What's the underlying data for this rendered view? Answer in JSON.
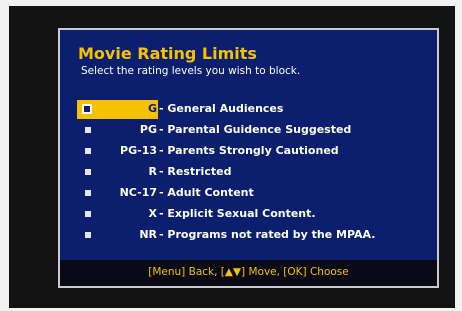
{
  "dialog": {
    "title": "Movie Rating Limits",
    "subtitle": "Select the rating levels you wish to block."
  },
  "ratings": [
    {
      "code": "G",
      "description": "- General Audiences",
      "selected": true
    },
    {
      "code": "PG",
      "description": "- Parental Guidence Suggested",
      "selected": false
    },
    {
      "code": "PG-13",
      "description": "- Parents Strongly Cautioned",
      "selected": false
    },
    {
      "code": "R",
      "description": "- Restricted",
      "selected": false
    },
    {
      "code": "NC-17",
      "description": "- Adult Content",
      "selected": false
    },
    {
      "code": "X",
      "description": "- Explicit Sexual Content.",
      "selected": false
    },
    {
      "code": "NR",
      "description": "- Programs not rated by the MPAA.",
      "selected": false
    }
  ],
  "footer": {
    "hint": "[Menu] Back, [▲▼] Move, [OK] Choose"
  },
  "colors": {
    "dialog_background": "#0b1f6e",
    "accent": "#f5c200",
    "text": "#ffffff",
    "footer_background": "#0a0a17"
  }
}
